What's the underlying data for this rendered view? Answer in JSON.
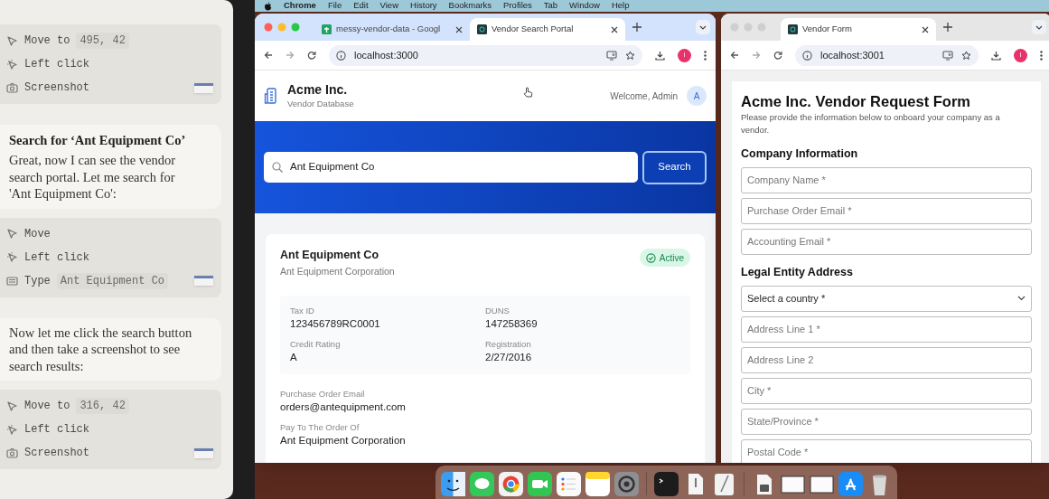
{
  "assistant_panel": {
    "steps": [
      {
        "kind": "actions",
        "actions": [
          {
            "kind": "move",
            "label": "Move to",
            "arg": "495, 42"
          },
          {
            "kind": "click",
            "label": "Left click"
          },
          {
            "kind": "screenshot",
            "label": "Screenshot"
          }
        ]
      },
      {
        "kind": "message",
        "title": "Search for ‘Ant Equipment Co’",
        "text": "Great, now I can see the vendor search portal. Let me search for 'Ant Equipment Co':"
      },
      {
        "kind": "actions",
        "actions": [
          {
            "kind": "move",
            "label": "Move"
          },
          {
            "kind": "click",
            "label": "Left click"
          },
          {
            "kind": "type",
            "label": "Type",
            "arg": "Ant Equipment Co"
          }
        ]
      },
      {
        "kind": "message",
        "text": "Now let me click the search button and then take a screenshot to see search results:"
      },
      {
        "kind": "actions",
        "actions": [
          {
            "kind": "move",
            "label": "Move to",
            "arg": "316, 42"
          },
          {
            "kind": "click",
            "label": "Left click"
          },
          {
            "kind": "screenshot",
            "label": "Screenshot"
          }
        ]
      }
    ]
  },
  "menu_bar": {
    "app": "Chrome",
    "items": [
      "File",
      "Edit",
      "View",
      "History",
      "Bookmarks",
      "Profiles",
      "Tab",
      "Window",
      "Help"
    ]
  },
  "browser_windows": [
    {
      "kind": "portal",
      "active": true,
      "url": "localhost:3000",
      "avatar": "I",
      "tabs": [
        {
          "kind": "sheet",
          "title": "messy-vendor-data - Googl",
          "selected": false
        },
        {
          "kind": "app",
          "title": "Vendor Search Portal",
          "selected": true
        }
      ]
    },
    {
      "kind": "form",
      "active": false,
      "url": "localhost:3001",
      "avatar": "I",
      "tabs": [
        {
          "kind": "app",
          "title": "Vendor Form",
          "selected": true
        }
      ]
    }
  ],
  "vendor_portal": {
    "company": "Acme Inc.",
    "subtitle": "Vendor Database",
    "welcome": "Welcome, Admin",
    "avatar": "A",
    "search_value": "Ant Equipment Co",
    "search_button": "Search",
    "vendor": {
      "name": "Ant Equipment Co",
      "legal_name": "Ant Equipment Corporation",
      "status": "Active",
      "details": [
        {
          "label": "Tax ID",
          "value": "123456789RC0001"
        },
        {
          "label": "DUNS",
          "value": "147258369"
        },
        {
          "label": "Credit Rating",
          "value": "A"
        },
        {
          "label": "Registration",
          "value": "2/27/2016"
        }
      ],
      "fields": [
        {
          "label": "Purchase Order Email",
          "value": "orders@antequipment.com"
        },
        {
          "label": "Pay To The Order Of",
          "value": "Ant Equipment Corporation"
        }
      ]
    }
  },
  "vendor_form": {
    "title": "Acme Inc. Vendor Request Form",
    "description": "Please provide the information below to onboard your company as a vendor.",
    "sections": [
      {
        "heading": "Company Information",
        "fields": [
          {
            "kind": "input",
            "placeholder": "Company Name *"
          },
          {
            "kind": "input",
            "placeholder": "Purchase Order Email *"
          },
          {
            "kind": "input",
            "placeholder": "Accounting Email *"
          }
        ]
      },
      {
        "heading": "Legal Entity Address",
        "fields": [
          {
            "kind": "select",
            "value": "Select a country *"
          },
          {
            "kind": "input",
            "placeholder": "Address Line 1 *"
          },
          {
            "kind": "input",
            "placeholder": "Address Line 2"
          },
          {
            "kind": "input",
            "placeholder": "City *"
          },
          {
            "kind": "input",
            "placeholder": "State/Province *"
          },
          {
            "kind": "input",
            "placeholder": "Postal Code *"
          }
        ]
      }
    ]
  }
}
